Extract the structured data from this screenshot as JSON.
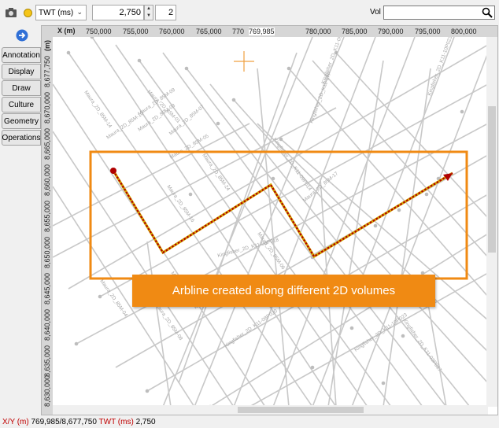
{
  "toolbar": {
    "domain_value": "TWT (ms)",
    "time_value": "2,750",
    "step_value": "2",
    "vol_label": "Vol",
    "vol_value": ""
  },
  "sidebar": {
    "tabs": [
      {
        "label": "Annotation"
      },
      {
        "label": "Display"
      },
      {
        "label": "Draw"
      },
      {
        "label": "Culture"
      },
      {
        "label": "Geometry"
      },
      {
        "label": "Operations"
      }
    ]
  },
  "map": {
    "x_axis_title": "X (m)",
    "y_axis_title": "(m)",
    "x_ticks": [
      "750,000",
      "755,000",
      "760,000",
      "765,000",
      "770",
      "769,985",
      "780,000",
      "785,000",
      "790,000",
      "795,000",
      "800,000"
    ],
    "y_ticks": [
      "8,677,750",
      "8,670,000",
      "8,665,000",
      "8,660,000",
      "8,655,000",
      "8,650,000",
      "8,645,000",
      "8,640,000",
      "8,635,000",
      "8,630,000"
    ],
    "line_labels": [
      "Maura_2D_85M-01",
      "Maura_2D_85M-03",
      "Maura_2D_85M-05",
      "Maura_2D_85M-07",
      "Maura_2D_85M-09",
      "Maura_2D_85M-10",
      "Maura_2D_85M-12",
      "Maura_2D_85M-14",
      "Maura_2D_85M-16",
      "Maura_2D_85M-24",
      "Maura_2D_85M-06",
      "Maura_2D_85M-08",
      "Maura_2D_85M-17",
      "Maura_2D_85M-04",
      "Kingfisher_2D_K11-17P",
      "Kingfisher_2D_K11-09P014",
      "Kingfisher_2D_K11-03P018",
      "Kingfisher_2D_K11-08P020",
      "Kingfisher_2D_K11-10P023",
      "Kingfisher_2D_K11-03P017",
      "Kingfisher_2D_K11-10P023",
      "Kingfisher_2D_K11-09P016"
    ],
    "callout_text": "Arbline created along different 2D volumes",
    "colors": {
      "survey_lines": "#c8c8c8",
      "arbline": "#c8a000",
      "arbline_core": "#b00000",
      "box": "#f08a13",
      "callout_bg": "#f08a13"
    }
  },
  "status": {
    "xy_label": "X/Y (m)",
    "xy_value": "769,985/8,677,750",
    "twt_label": "TWT (ms)",
    "twt_value": "2,750"
  }
}
